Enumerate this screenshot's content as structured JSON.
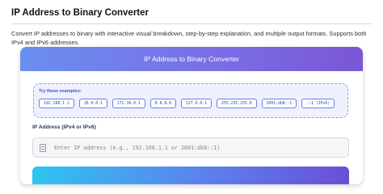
{
  "page": {
    "title": "IP Address to Binary Converter",
    "description": "Convert IP addresses to binary with interactive visual breakdown, step-by-step explanation, and multiple output formats. Supports both IPv4 and IPv6 addresses."
  },
  "card": {
    "header_title": "IP Address to Binary Converter",
    "examples_title": "Try these examples:",
    "examples": [
      "192.168.1.1",
      "10.0.0.1",
      "172.16.0.1",
      "8.8.8.8",
      "127.0.0.1",
      "255.255.255.0",
      "2001:db8::1",
      "::1 (IPv6)"
    ],
    "field_label": "IP Address (IPv4 or IPv6)",
    "input_value": "",
    "input_placeholder": "Enter IP address (e.g., 192.168.1.1 or 2001:db8::1)"
  }
}
